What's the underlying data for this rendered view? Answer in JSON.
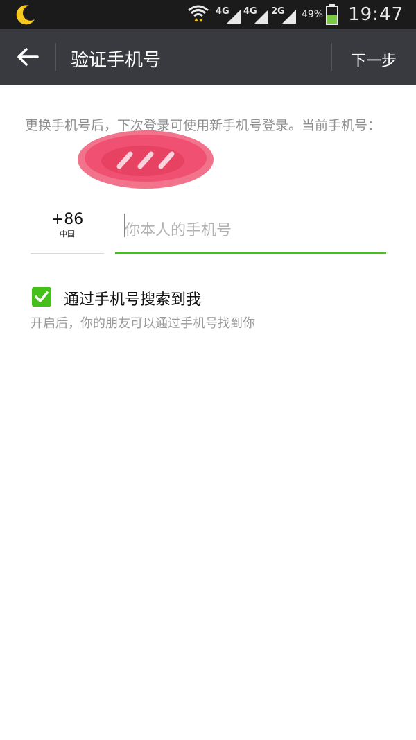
{
  "status_bar": {
    "network_1": "4G",
    "network_2": "4G",
    "network_3": "2G",
    "battery_percent": "49%",
    "battery_level": 0.49,
    "time": "19:47",
    "icons": [
      "moon-icon",
      "wifi-icon",
      "signal-icon",
      "battery-icon"
    ],
    "colors": {
      "moon": "#f7c91e",
      "wifi_arrows": "#f0c419",
      "battery_fill": "#7ac943"
    }
  },
  "app_bar": {
    "title": "验证手机号",
    "next_label": "下一步",
    "back_icon": "back-arrow-icon",
    "background": "#393a3f"
  },
  "content": {
    "hint_text": "更换手机号后，下次登录可使用新手机号登录。当前手机号：",
    "country_code": "+86",
    "country_name": "中国",
    "phone_placeholder": "你本人的手机号",
    "phone_value": "",
    "search_option": {
      "checked": true,
      "label": "通过手机号搜索到我",
      "description": "开启后，你的朋友可以通过手机号找到你"
    },
    "accent_color": "#45c01a"
  }
}
